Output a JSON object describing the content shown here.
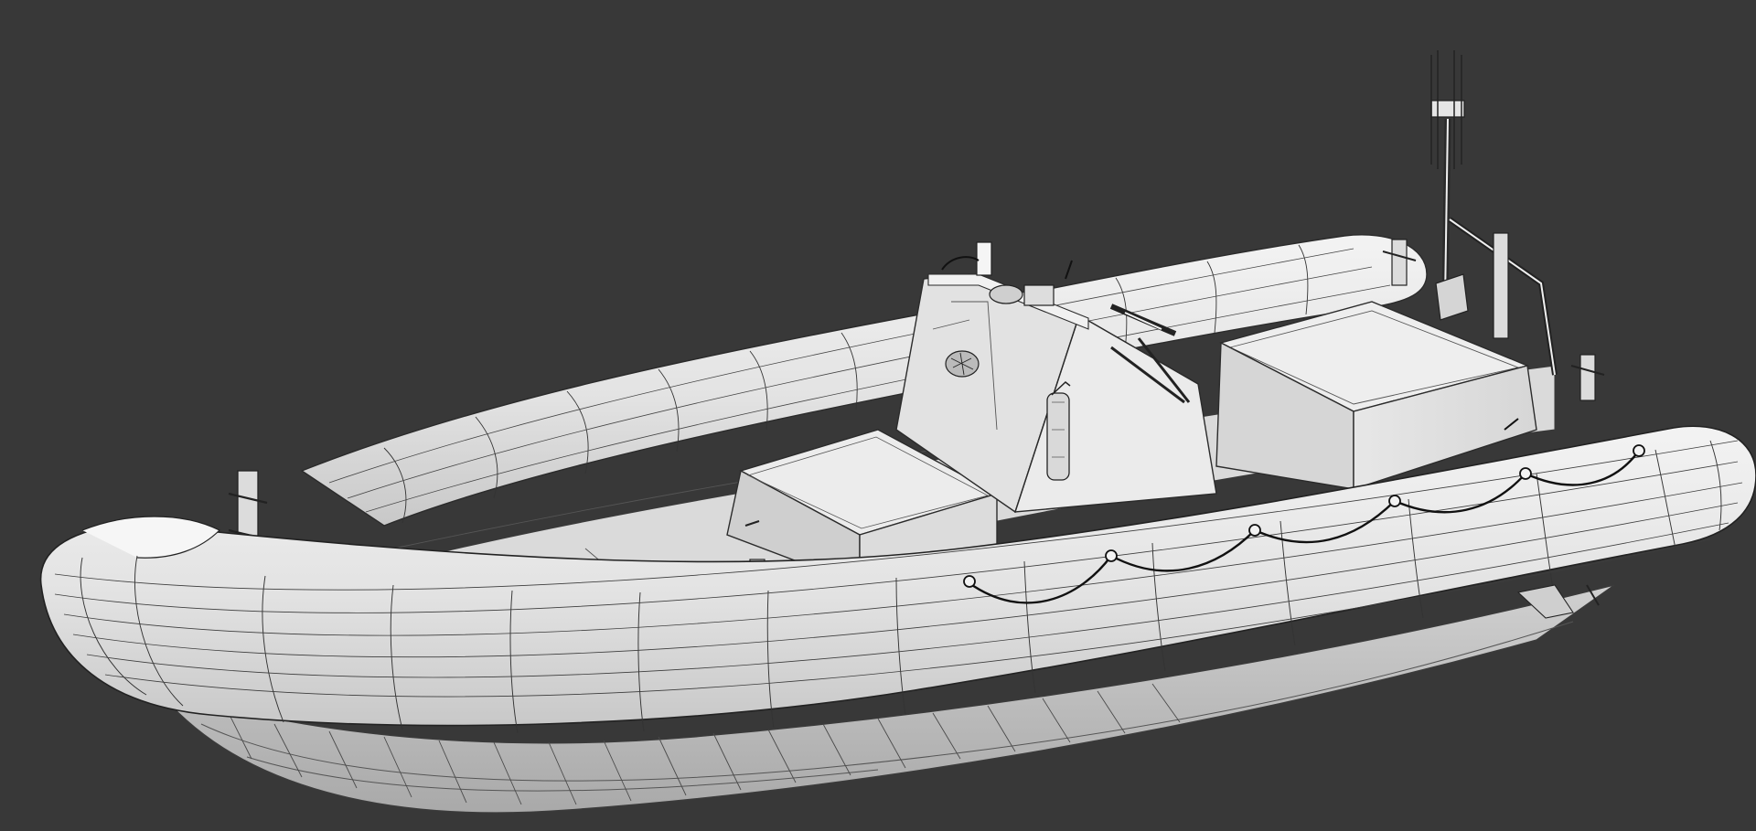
{
  "viewport": {
    "background_color": "#383838"
  },
  "model": {
    "subject": "rigid-inflatable-boat-wireframe",
    "surface_color": "#e9e9e9",
    "shadow_color": "#b9b9b9",
    "wire_color": "#222222",
    "rope_color": "#111111"
  }
}
